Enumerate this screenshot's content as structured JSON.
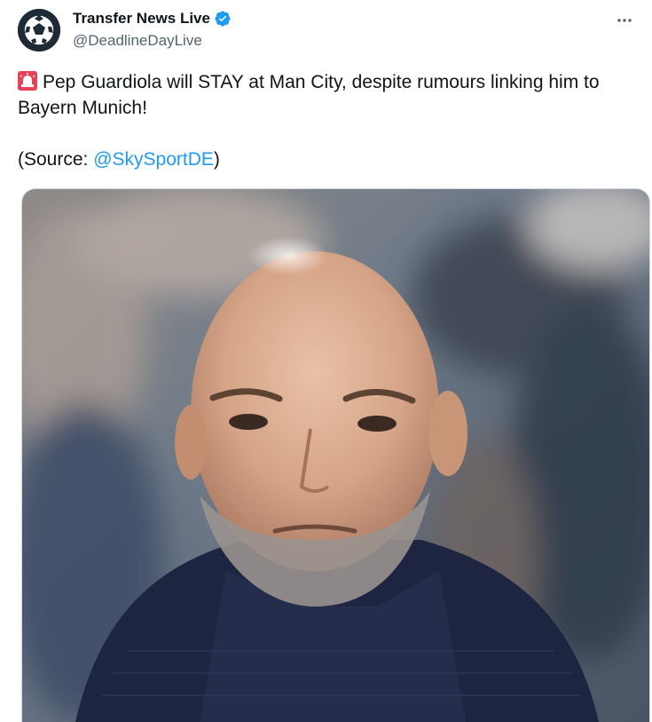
{
  "author": {
    "display_name": "Transfer News Live",
    "handle": "@DeadlineDayLive",
    "avatar_icon": "soccer-ball-icon",
    "verified_icon": "verified-badge-icon",
    "verified_color": "#1d9bf0"
  },
  "menu": {
    "icon": "more-horizontal-icon",
    "label": "···"
  },
  "tweet": {
    "emoji_icon": "siren-icon",
    "text_line1": "Pep Guardiola will STAY at Man City, despite rumours linking him to",
    "text_line2": "Bayern Munich!",
    "source_prefix": "(Source: ",
    "source_mention": "@SkySportDE",
    "source_suffix": ")"
  },
  "media": {
    "type": "photo",
    "accent_colors": {
      "jumper": "#1d2540",
      "skin": "#d9a88c",
      "background": "#6b7888"
    }
  },
  "colors": {
    "text": "#0f1419",
    "muted": "#536471",
    "link": "#1d9bf0"
  }
}
